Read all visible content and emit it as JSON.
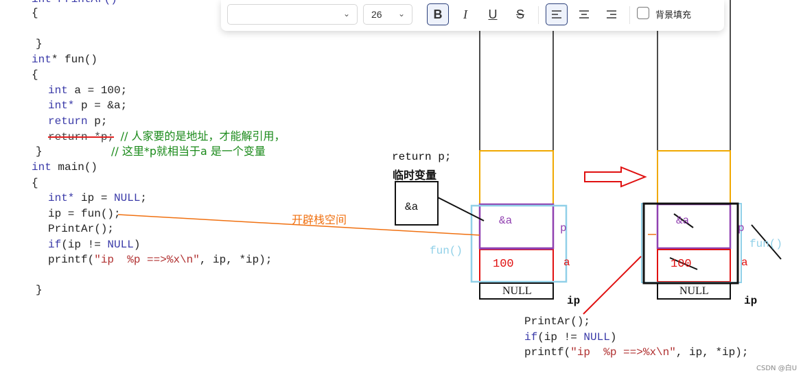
{
  "code": {
    "line0": "int PrintAr()",
    "line1": "{",
    "line2": "}",
    "fun_sig": "int* fun()",
    "brace_open": "{",
    "int_kw1": "int",
    "decl_a": " a = 100;",
    "int_kw2": "int*",
    "decl_p": " p = &a;",
    "return_kw": "return",
    "return_p": " p;",
    "return_struck": "return *p;",
    "comment1": "// 人家要的是地址，才能解引用，",
    "brace_close": "}",
    "comment2": "// 这里*p就相当于a 是一个变量",
    "main_sig_kw": "int",
    "main_sig": " main()",
    "main_brace": "{",
    "ip_kw": "int*",
    "ip_decl": " ip = ",
    "null_kw": "NULL",
    "semi": ";",
    "ip_assign": "ip = fun();",
    "printar": "PrintAr();",
    "if_kw": "if",
    "if_cond_a": "(ip != ",
    "if_cond_b": ")",
    "printf_a": "printf(",
    "printf_str": "\"ip  %p ==>%x\\n\"",
    "printf_b": ", ip, *ip);",
    "main_close": "}"
  },
  "toolbar": {
    "font_family_value": "",
    "font_size_value": "26",
    "bold": "B",
    "italic": "I",
    "underline": "U",
    "strike": "S",
    "fill_label": "背景填充"
  },
  "diagram": {
    "return_label": "return p;",
    "temp_var_label": "临时变量",
    "temp_box_value": "&a",
    "open_stack_label": "开辟栈空间",
    "fun_label": "fun()",
    "cell_p_value": "&a",
    "cell_a_value": "100",
    "label_p": "p",
    "label_a": "a",
    "null_cell": "NULL",
    "label_ip": "ip",
    "right_fun_label": "fun()",
    "right_cell_p_value": "&a",
    "right_cell_a_value": "100",
    "right_label_p": "p",
    "right_label_a": "a",
    "right_null_cell": "NULL",
    "right_label_ip": "ip",
    "bottom_printar": "PrintAr();",
    "bottom_if_kw": "if",
    "bottom_if_a": "(ip != ",
    "bottom_null": "NULL",
    "bottom_if_b": ")",
    "bottom_printf_a": "printf(",
    "bottom_printf_str": "\"ip  %p ==>%x\\n\"",
    "bottom_printf_b": ", ip, *ip);"
  },
  "watermark": "CSDN @白U",
  "colors": {
    "orange": "#f0a800",
    "purple": "#9040b0",
    "cyan": "#90d0e8",
    "red": "#e01010",
    "orange_line": "#f07010"
  }
}
